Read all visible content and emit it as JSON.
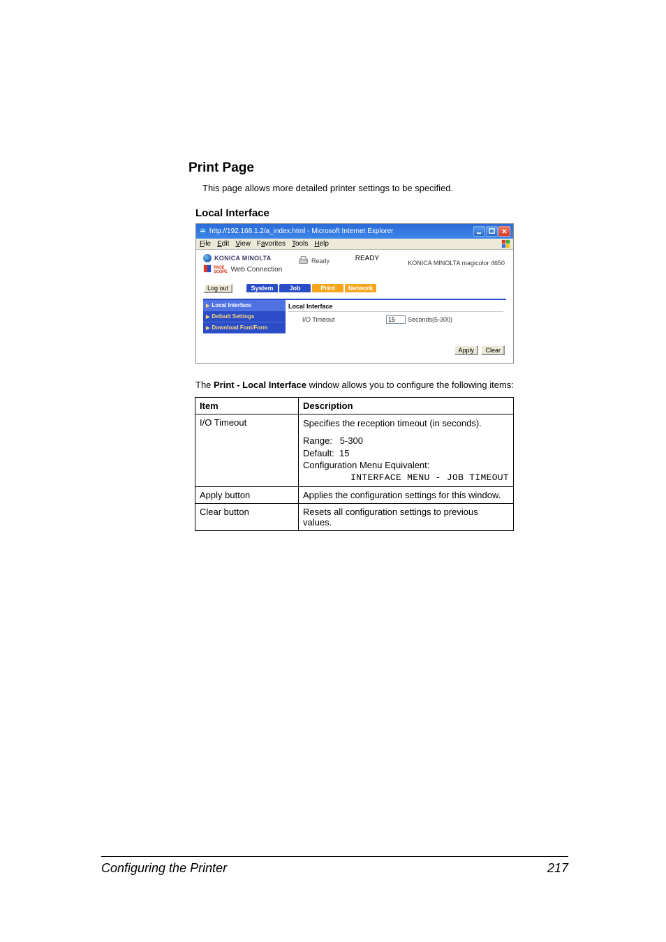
{
  "headings": {
    "print_page": "Print Page",
    "local_interface": "Local Interface"
  },
  "intro_text": "This page allows more detailed printer settings to be specified.",
  "screenshot": {
    "title": "http://192.168.1.2/a_index.html - Microsoft Internet Explorer",
    "menu": {
      "file": "File",
      "edit": "Edit",
      "view": "View",
      "favorites": "Favorites",
      "tools": "Tools",
      "help": "Help"
    },
    "brand": {
      "km": "KONICA MINOLTA",
      "ps": "Web Connection"
    },
    "status": {
      "label": "Ready",
      "big": "READY"
    },
    "model": "KONICA MINOLTA magicolor 4650",
    "logout": "Log out",
    "tabs": {
      "system": "System",
      "job": "Job",
      "print": "Print",
      "network": "Network"
    },
    "sidebar": {
      "local": "Local Interface",
      "default": "Default Settings",
      "download": "Download Font/Form"
    },
    "pane": {
      "header": "Local Interface",
      "field_label": "I/O Timeout",
      "value": "15",
      "suffix": "Seconds(5-300)"
    },
    "buttons": {
      "apply": "Apply",
      "clear": "Clear"
    }
  },
  "desc_paragraph": {
    "pre": "The ",
    "bold": "Print - Local Interface",
    "post": " window allows you to configure the following items:"
  },
  "table": {
    "head": {
      "item": "Item",
      "desc": "Description"
    },
    "rows": {
      "r1": {
        "item": "I/O Timeout",
        "line1": "Specifies the reception timeout (in seconds).",
        "range": "Range:   5-300",
        "default": "Default:  15",
        "equiv": "Configuration Menu Equivalent:",
        "mono": "INTERFACE MENU - JOB TIMEOUT"
      },
      "r2": {
        "item": "Apply button",
        "desc": "Applies the configuration settings for this window."
      },
      "r3": {
        "item": "Clear button",
        "desc": "Resets all configuration settings to previous values."
      }
    }
  },
  "footer": {
    "left": "Configuring the Printer",
    "right": "217"
  }
}
